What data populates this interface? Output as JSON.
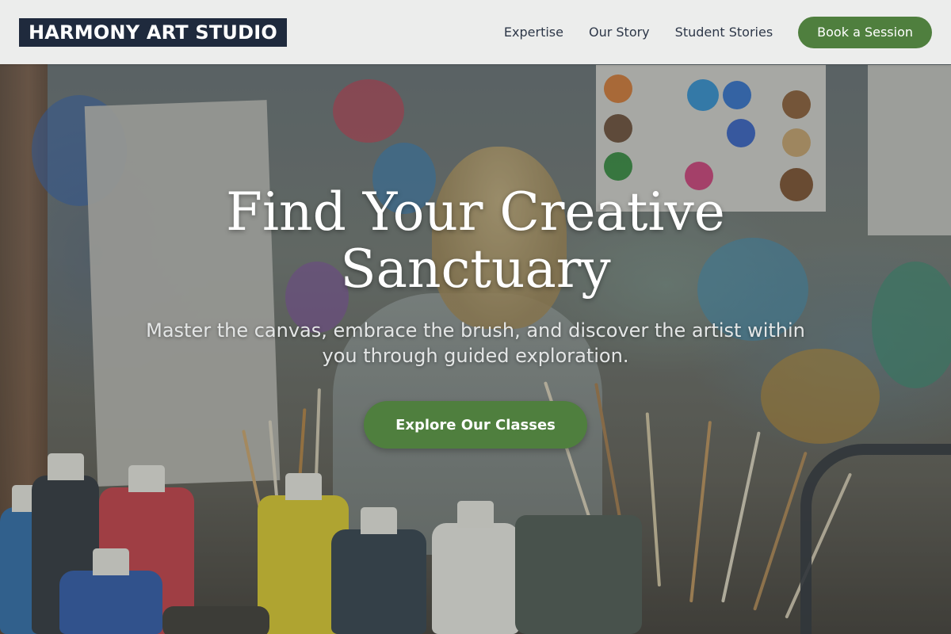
{
  "brand": {
    "name": "HARMONY ART STUDIO"
  },
  "nav": {
    "links": [
      "Expertise",
      "Our Story",
      "Student Stories"
    ],
    "cta_label": "Book a Session"
  },
  "hero": {
    "title_line1": "Find Your Creative",
    "title_line2": "Sanctuary",
    "subtitle_line1": "Master the canvas, embrace the brush, and discover the artist within",
    "subtitle_line2": "you through guided exploration.",
    "cta_label": "Explore Our Classes",
    "background_image": "art studio with child painting, paint bottles and brushes"
  },
  "colors": {
    "brand_dark": "#1f2a3d",
    "accent_green": "#4f7f3e",
    "nav_background": "#f2f2f1"
  }
}
